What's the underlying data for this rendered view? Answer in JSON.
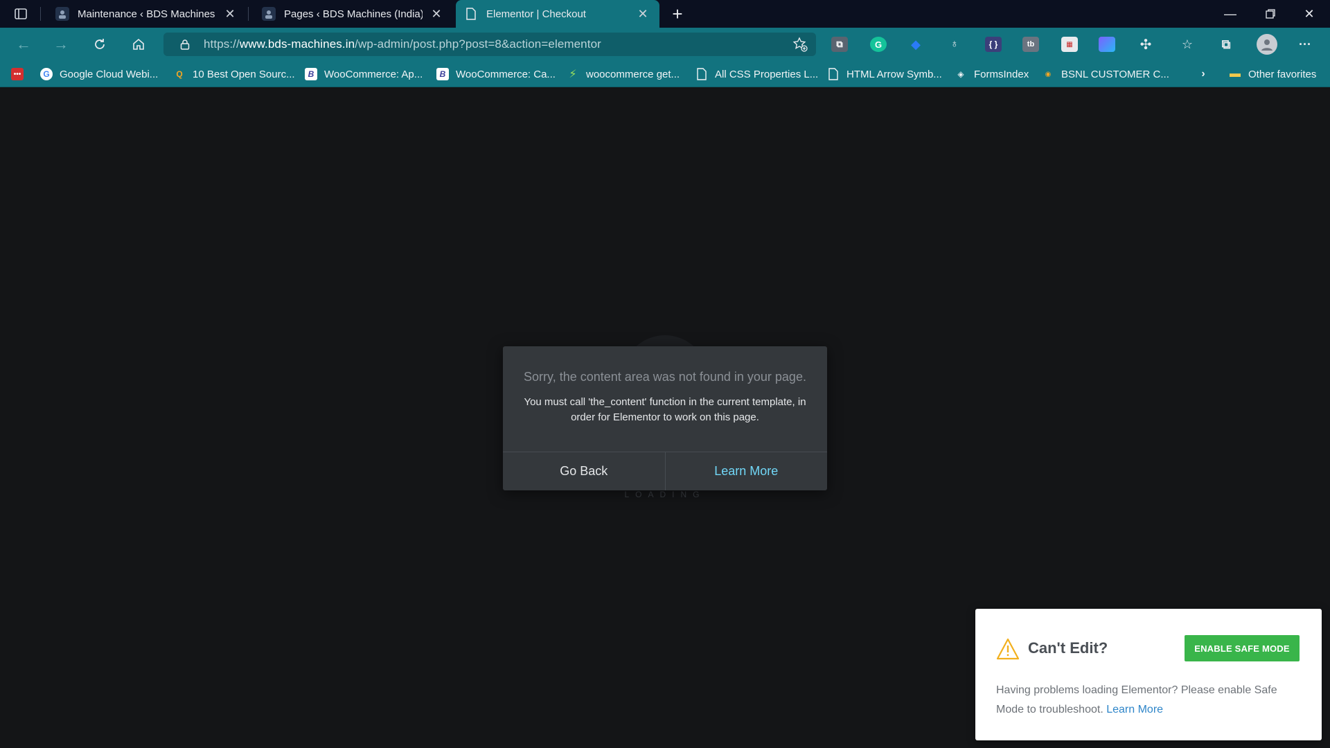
{
  "browser": {
    "tabs": [
      {
        "title": "Maintenance ‹ BDS Machines (India) Online",
        "active": false
      },
      {
        "title": "Pages ‹ BDS Machines (India) Online",
        "active": false
      },
      {
        "title": "Elementor | Checkout",
        "active": true
      }
    ],
    "address": {
      "prefix": "https://",
      "host": "www.bds-machines.in",
      "path": "/wp-admin/post.php?post=8&action=elementor"
    },
    "bookmarks": [
      {
        "label": "Google Cloud Webi...",
        "icon": "google-icon"
      },
      {
        "label": "10 Best Open Sourc...",
        "icon": "search-icon"
      },
      {
        "label": "WooCommerce: Ap...",
        "icon": "b-icon"
      },
      {
        "label": "WooCommerce: Ca...",
        "icon": "b-icon"
      },
      {
        "label": "woocommerce get...",
        "icon": "spark-icon"
      },
      {
        "label": "All CSS Properties L...",
        "icon": "page-icon"
      },
      {
        "label": "HTML Arrow Symb...",
        "icon": "page-icon"
      },
      {
        "label": "FormsIndex",
        "icon": "diamond-icon"
      },
      {
        "label": "BSNL CUSTOMER C...",
        "icon": "bsnl-icon"
      }
    ],
    "other_favorites": "Other favorites"
  },
  "page": {
    "loading": "LOADING",
    "dialog": {
      "header": "Sorry, the content area was not found in your page.",
      "message": "You must call 'the_content' function in the current template, in order for Elementor to work on this page.",
      "go_back": "Go Back",
      "learn_more": "Learn More"
    },
    "safe_mode": {
      "title": "Can't Edit?",
      "button": "ENABLE SAFE MODE",
      "body": "Having problems loading Elementor? Please enable Safe Mode to troubleshoot.",
      "link": "Learn More"
    }
  },
  "colors": {
    "accent": "#12737f",
    "safe_button": "#39b54a",
    "link": "#71d7f7"
  }
}
